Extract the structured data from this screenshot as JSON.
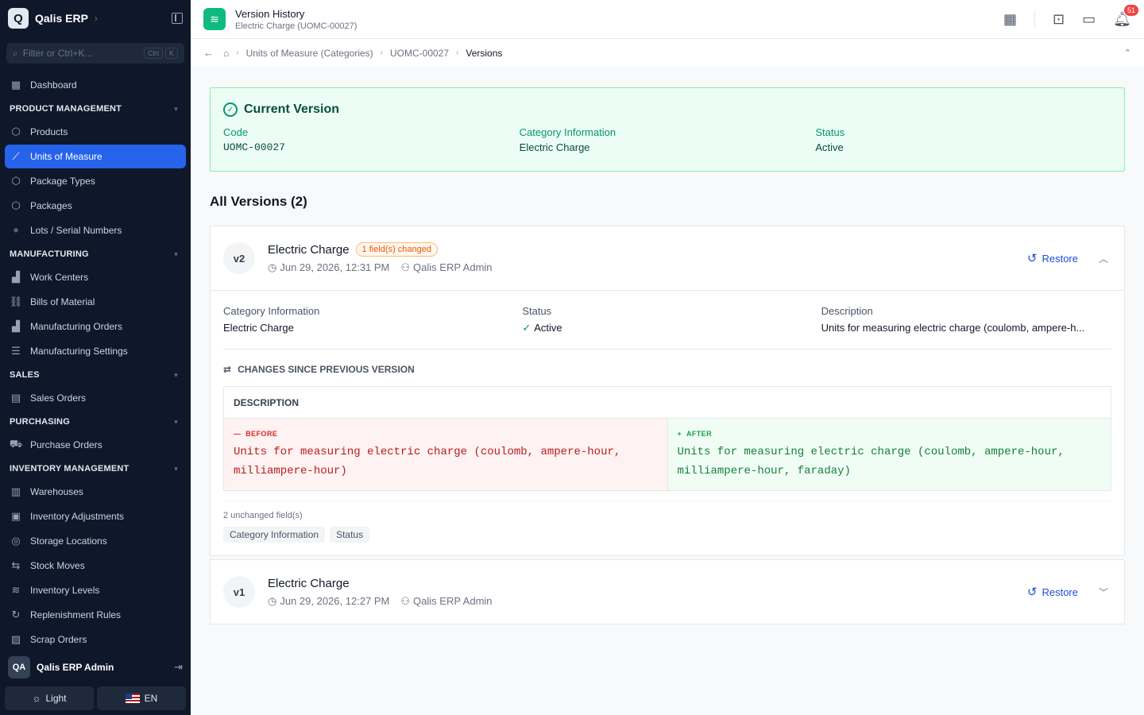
{
  "app": {
    "name": "Qalis ERP",
    "logo_letter": "Q"
  },
  "sidebar": {
    "filter_placeholder": "Filter or Ctrl+K...",
    "kbd": [
      "Ctrl",
      "K"
    ],
    "groups": [
      {
        "section": null,
        "items": [
          {
            "label": "Dashboard",
            "icon": "dashboard-icon"
          }
        ]
      },
      {
        "section": "PRODUCT MANAGEMENT",
        "items": [
          {
            "label": "Products",
            "icon": "box-icon"
          },
          {
            "label": "Units of Measure",
            "icon": "ruler-icon",
            "active": true
          },
          {
            "label": "Package Types",
            "icon": "box-icon"
          },
          {
            "label": "Packages",
            "icon": "box-icon"
          },
          {
            "label": "Lots / Serial Numbers",
            "icon": "tag-icon"
          }
        ]
      },
      {
        "section": "MANUFACTURING",
        "items": [
          {
            "label": "Work Centers",
            "icon": "factory-icon"
          },
          {
            "label": "Bills of Material",
            "icon": "hierarchy-icon"
          },
          {
            "label": "Manufacturing Orders",
            "icon": "factory-icon"
          },
          {
            "label": "Manufacturing Settings",
            "icon": "sliders-icon"
          }
        ]
      },
      {
        "section": "SALES",
        "items": [
          {
            "label": "Sales Orders",
            "icon": "document-icon"
          }
        ]
      },
      {
        "section": "PURCHASING",
        "items": [
          {
            "label": "Purchase Orders",
            "icon": "cart-icon"
          }
        ]
      },
      {
        "section": "INVENTORY MANAGEMENT",
        "items": [
          {
            "label": "Warehouses",
            "icon": "warehouse-icon"
          },
          {
            "label": "Inventory Adjustments",
            "icon": "clipboard-icon"
          },
          {
            "label": "Storage Locations",
            "icon": "pin-icon"
          },
          {
            "label": "Stock Moves",
            "icon": "arrows-icon"
          },
          {
            "label": "Inventory Levels",
            "icon": "layers-icon"
          },
          {
            "label": "Replenishment Rules",
            "icon": "refresh-icon"
          },
          {
            "label": "Scrap Orders",
            "icon": "trash-icon"
          }
        ]
      }
    ],
    "user": {
      "initials": "QA",
      "name": "Qalis ERP Admin"
    },
    "theme_label": "Light",
    "lang_label": "EN"
  },
  "header": {
    "title": "Version History",
    "subtitle": "Electric Charge (UOMC-00027)",
    "notifications": "51"
  },
  "breadcrumb": [
    "Units of Measure (Categories)",
    "UOMC-00027",
    "Versions"
  ],
  "current": {
    "title": "Current Version",
    "fields": [
      {
        "label": "Code",
        "value": "UOMC-00027"
      },
      {
        "label": "Category Information",
        "value": "Electric Charge"
      },
      {
        "label": "Status",
        "value": "Active"
      }
    ]
  },
  "all_versions_title": "All Versions (2)",
  "versions": [
    {
      "tag": "v2",
      "name": "Electric Charge",
      "badge": "1 field(s) changed",
      "date": "Jun 29, 2026, 12:31 PM",
      "user": "Qalis ERP Admin",
      "restore": "Restore",
      "fields": [
        {
          "label": "Category Information",
          "value": "Electric Charge"
        },
        {
          "label": "Status",
          "value": "Active"
        },
        {
          "label": "Description",
          "value": "Units for measuring electric charge (coulomb, ampere-h..."
        }
      ],
      "changes_title": "CHANGES SINCE PREVIOUS VERSION",
      "diff": {
        "field": "DESCRIPTION",
        "before_label": "BEFORE",
        "before": "Units for measuring electric charge (coulomb, ampere-hour, milliampere-hour)",
        "after_label": "AFTER",
        "after": "Units for measuring electric charge (coulomb, ampere-hour, milliampere-hour, faraday)"
      },
      "unchanged_label": "2 unchanged field(s)",
      "unchanged": [
        "Category Information",
        "Status"
      ]
    },
    {
      "tag": "v1",
      "name": "Electric Charge",
      "date": "Jun 29, 2026, 12:27 PM",
      "user": "Qalis ERP Admin",
      "restore": "Restore"
    }
  ],
  "colors": {
    "accent": "#2563eb",
    "success": "#059669",
    "sidebar_bg": "#0f172a"
  }
}
